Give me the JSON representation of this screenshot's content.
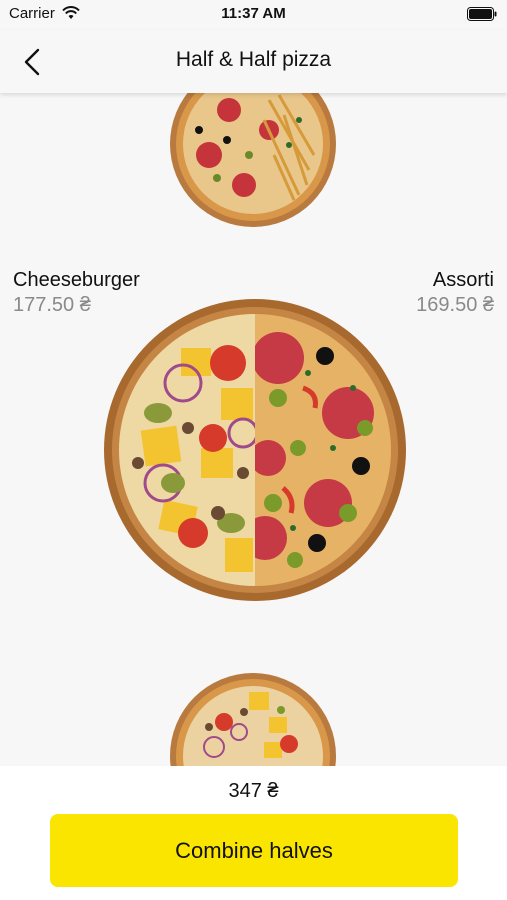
{
  "status_bar": {
    "carrier": "Carrier",
    "time": "11:37 AM"
  },
  "nav": {
    "title": "Half & Half pizza"
  },
  "left_half": {
    "name": "Cheeseburger",
    "price": "177.50 ₴"
  },
  "right_half": {
    "name": "Assorti",
    "price": "169.50 ₴"
  },
  "footer": {
    "total": "347 ₴",
    "button_label": "Combine halves"
  },
  "colors": {
    "accent": "#f9e500",
    "price_gray": "#8a8a8a",
    "background": "#f7f7f7"
  },
  "icons": {
    "back": "chevron-left-icon",
    "wifi": "wifi-icon",
    "battery": "battery-icon"
  }
}
